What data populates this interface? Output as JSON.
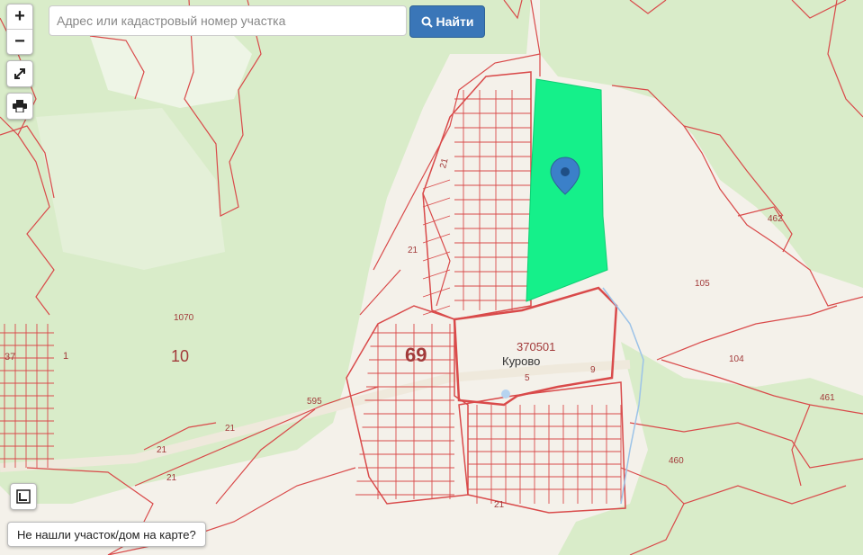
{
  "search": {
    "placeholder": "Адрес или кадастровый номер участка",
    "button_label": "Найти"
  },
  "controls": {
    "zoom_in": "+",
    "zoom_out": "−"
  },
  "not_found_button": "Не нашли участок/дом на карте?",
  "map_labels": {
    "village": "Курово",
    "quarter": "370501",
    "district_69": "69",
    "district_10": "10",
    "p1070": "1070",
    "p37": "37",
    "p1": "1",
    "p595": "595",
    "p21a": "21",
    "p21b": "21",
    "p21c": "21",
    "p21d": "21",
    "p21e": "21",
    "p21f": "21",
    "p105": "105",
    "p104": "104",
    "p462": "462",
    "p461": "461",
    "p460": "460",
    "p9": "9",
    "p5": "5"
  },
  "colors": {
    "forest": "#d9ecc9",
    "boundary": "#d94a4a",
    "selected_parcel": "#15f08a",
    "marker": "#3b80c9"
  }
}
